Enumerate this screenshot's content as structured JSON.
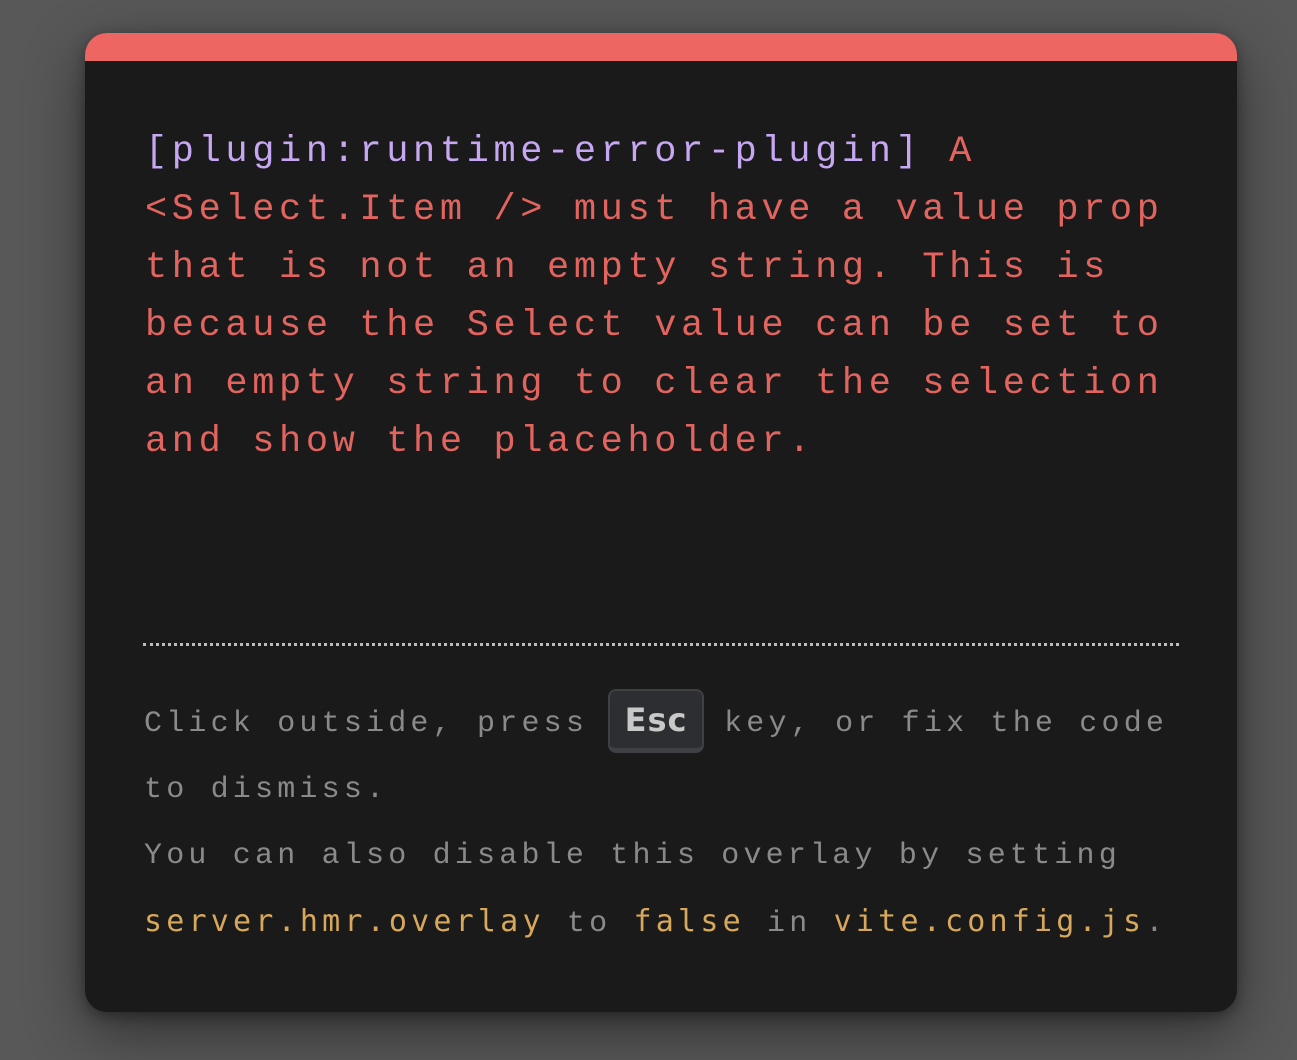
{
  "overlay": {
    "plugin": "[plugin:runtime-error-plugin]",
    "message": " A <Select.Item /> must have a value prop that is not an empty string. This is because the Select value can be set to an empty string to clear the selection and show the placeholder.",
    "tip": {
      "before_key": "Click outside, press",
      "key": "Esc",
      "after_key": "key, or fix the code",
      "line2": "to dismiss.",
      "line3": "You can also disable this overlay by setting",
      "config_key": "server.hmr.overlay",
      "to": " to ",
      "false_value": "false",
      "in": " in ",
      "config_file": "vite.config.js",
      "period": "."
    }
  },
  "colors": {
    "top_bar": "#ed6661",
    "error_text": "#e1645f",
    "plugin_text": "#c6a7f1",
    "tip_text": "#8a8a8a",
    "code_text": "#d7a85b",
    "background": "#1a1a1a"
  }
}
